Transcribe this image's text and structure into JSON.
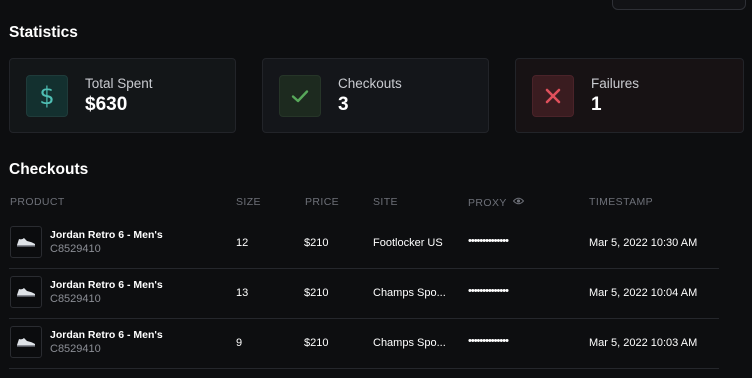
{
  "statistics": {
    "title": "Statistics",
    "cards": [
      {
        "label": "Total Spent",
        "value": "$630",
        "icon": "dollar-icon",
        "accent": "#4fbfb4"
      },
      {
        "label": "Checkouts",
        "value": "3",
        "icon": "check-icon",
        "accent": "#57a85a"
      },
      {
        "label": "Failures",
        "value": "1",
        "icon": "close-icon",
        "accent": "#e0505c"
      }
    ]
  },
  "checkouts": {
    "title": "Checkouts",
    "columns": {
      "product": "PRODUCT",
      "size": "SIZE",
      "price": "PRICE",
      "site": "SITE",
      "proxy": "PROXY",
      "timestamp": "TIMESTAMP"
    },
    "rows": [
      {
        "name": "Jordan Retro 6 - Men's",
        "sku": "C8529410",
        "size": "12",
        "price": "$210",
        "site": "Footlocker US",
        "proxy": "••••••••••••••",
        "timestamp": "Mar 5, 2022 10:30 AM"
      },
      {
        "name": "Jordan Retro 6 - Men's",
        "sku": "C8529410",
        "size": "13",
        "price": "$210",
        "site": "Champs Spo...",
        "proxy": "••••••••••••••",
        "timestamp": "Mar 5, 2022 10:04 AM"
      },
      {
        "name": "Jordan Retro 6 - Men's",
        "sku": "C8529410",
        "size": "9",
        "price": "$210",
        "site": "Champs Spo...",
        "proxy": "••••••••••••••",
        "timestamp": "Mar 5, 2022 10:03 AM"
      }
    ]
  }
}
